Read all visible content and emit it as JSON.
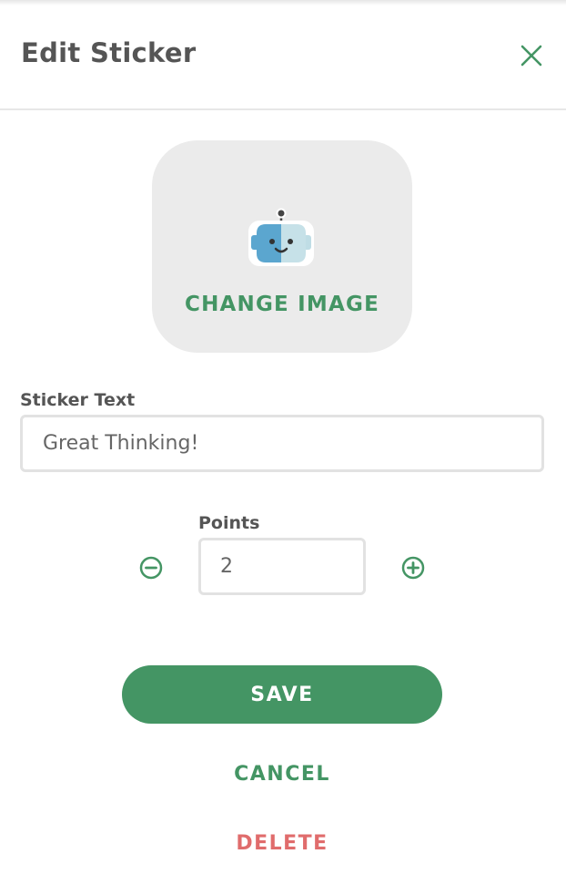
{
  "header": {
    "title": "Edit Sticker",
    "close_icon": "close-icon"
  },
  "image": {
    "icon": "robot-icon",
    "change_label": "CHANGE IMAGE"
  },
  "sticker_text": {
    "label": "Sticker Text",
    "value": "Great Thinking!"
  },
  "points": {
    "label": "Points",
    "value": "2",
    "decrement_icon": "minus-circle-icon",
    "increment_icon": "plus-circle-icon"
  },
  "actions": {
    "save_label": "SAVE",
    "cancel_label": "CANCEL",
    "delete_label": "DELETE"
  },
  "colors": {
    "accent": "#449564",
    "danger": "#e06c6c",
    "text": "#555555",
    "image_bg": "#ebebeb",
    "border": "#e2e2e2"
  }
}
